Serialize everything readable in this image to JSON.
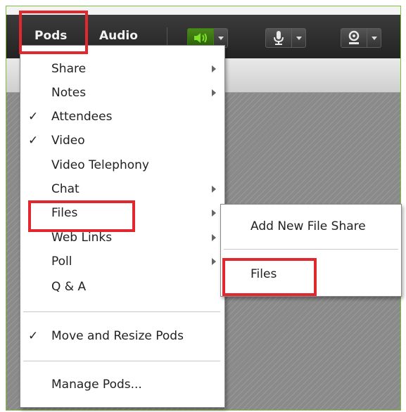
{
  "toolbar": {
    "pods_label": "Pods",
    "audio_label": "Audio",
    "speaker_icon": "speaker-icon",
    "mic_icon": "microphone-icon",
    "camera_icon": "webcam-icon",
    "active_color": "#3f7a15"
  },
  "pods_menu": {
    "items": [
      {
        "label": "Share",
        "checked": false,
        "submenu": true
      },
      {
        "label": "Notes",
        "checked": false,
        "submenu": true
      },
      {
        "label": "Attendees",
        "checked": true,
        "submenu": false
      },
      {
        "label": "Video",
        "checked": true,
        "submenu": false
      },
      {
        "label": "Video Telephony",
        "checked": false,
        "submenu": false
      },
      {
        "label": "Chat",
        "checked": false,
        "submenu": true
      },
      {
        "label": "Files",
        "checked": false,
        "submenu": true
      },
      {
        "label": "Web Links",
        "checked": false,
        "submenu": true
      },
      {
        "label": "Poll",
        "checked": false,
        "submenu": true
      },
      {
        "label": "Q & A",
        "checked": false,
        "submenu": false
      },
      {
        "label": "Move and Resize Pods",
        "checked": true,
        "submenu": false
      },
      {
        "label": "Manage Pods...",
        "checked": false,
        "submenu": false
      }
    ],
    "checkmark": "✓"
  },
  "files_submenu": {
    "items": [
      {
        "label": "Add New File Share"
      },
      {
        "label": "Files"
      }
    ]
  },
  "highlight_color": "#e0282e"
}
